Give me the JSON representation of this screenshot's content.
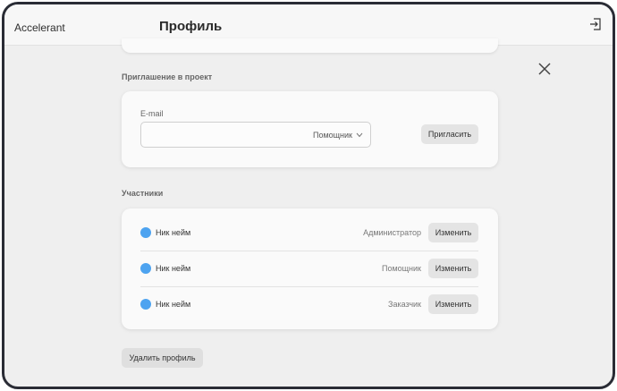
{
  "header": {
    "brand": "Accelerant",
    "title": "Профиль"
  },
  "invite": {
    "section_title": "Приглашение в проект",
    "email_label": "E-mail",
    "email_value": "",
    "role_value": "Помощник",
    "invite_button": "Пригласить"
  },
  "members": {
    "section_title": "Участники",
    "rows": [
      {
        "name": "Ник нейм",
        "role": "Администратор",
        "action": "Изменить"
      },
      {
        "name": "Ник нейм",
        "role": "Помощник",
        "action": "Изменить"
      },
      {
        "name": "Ник нейм",
        "role": "Заказчик",
        "action": "Изменить"
      }
    ]
  },
  "delete_button": "Удалить профиль",
  "colors": {
    "avatar": "#4da3f0",
    "button_bg": "#e4e4e4",
    "page_bg": "#efefef"
  },
  "icons": {
    "logout": "logout-icon",
    "close": "close-icon",
    "dropdown": "chevron-down-icon"
  }
}
